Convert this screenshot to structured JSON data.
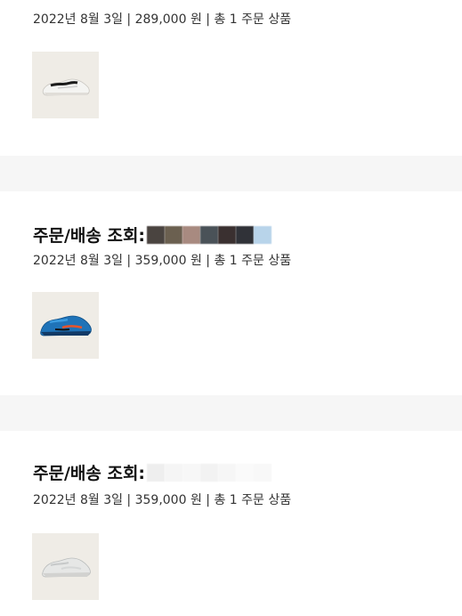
{
  "orders": [
    {
      "heading": "",
      "meta": "2022년 8월 3일 | 289,000 원 | 총 1 주문 상품",
      "thumb_bg": "#efece6",
      "shoe_icon": "white-sneaker-icon"
    },
    {
      "heading": "주문/배송 조회:",
      "meta": "2022년 8월 3일 | 359,000 원 | 총 1 주문 상품",
      "thumb_bg": "#efece6",
      "shoe_icon": "blue-sneaker-icon",
      "redacted_colors": [
        "#4a4440",
        "#6b6050",
        "#a88a80",
        "#4a5258",
        "#3a3030",
        "#303238",
        "#b8d4ea"
      ]
    },
    {
      "heading": "주문/배송 조회:",
      "meta": "2022년 8월 3일 | 359,000 원 | 총 1 주문 상품",
      "thumb_bg": "#efece6",
      "shoe_icon": "grey-sneaker-icon"
    }
  ],
  "colors": {
    "separator": "#f6f6f6",
    "text": "#333333"
  }
}
